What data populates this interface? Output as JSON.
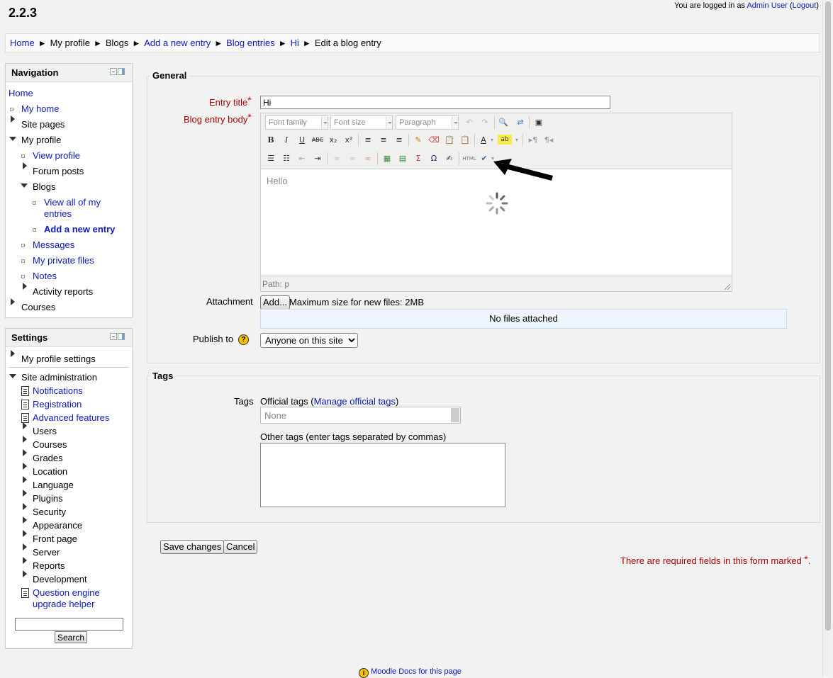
{
  "site": {
    "title": "2.2.3",
    "login_prefix": "You are logged in as ",
    "user_name": "Admin User",
    "logout_label": "Logout"
  },
  "breadcrumb": {
    "items": [
      "Home",
      "My profile",
      "Blogs",
      "Add a new entry",
      "Blog entries",
      "Hi",
      "Edit a blog entry"
    ],
    "separator": "►"
  },
  "navigation": {
    "title": "Navigation",
    "home": "Home",
    "my_home": "My home",
    "site_pages": "Site pages",
    "my_profile": "My profile",
    "view_profile": "View profile",
    "forum_posts": "Forum posts",
    "blogs": "Blogs",
    "view_all_line1": "View all of my",
    "view_all_line2": "entries",
    "add_new_entry": "Add a new entry",
    "messages": "Messages",
    "my_private_files": "My private files",
    "notes": "Notes",
    "activity_reports": "Activity reports",
    "courses": "Courses"
  },
  "settings": {
    "title": "Settings",
    "my_profile_settings": "My profile settings",
    "site_administration": "Site administration",
    "notifications": "Notifications",
    "registration": "Registration",
    "advanced_features": "Advanced features",
    "users": "Users",
    "courses": "Courses",
    "grades": "Grades",
    "location": "Location",
    "language": "Language",
    "plugins": "Plugins",
    "security": "Security",
    "appearance": "Appearance",
    "front_page": "Front page",
    "server": "Server",
    "reports": "Reports",
    "development": "Development",
    "question_engine_line1": "Question engine",
    "question_engine_line2": "upgrade helper",
    "search_button": "Search"
  },
  "form": {
    "general_legend": "General",
    "entry_title_label": "Entry title",
    "entry_title_value": "Hi",
    "body_label": "Blog entry body",
    "editor": {
      "font_family": "Font family",
      "font_size": "Font size",
      "format": "Paragraph",
      "content": "Hello",
      "path": "Path: p"
    },
    "attachment_label": "Attachment",
    "add_button": "Add...",
    "max_size": "Maximum size for new files: 2MB",
    "no_files": "No files attached",
    "publish_label": "Publish to",
    "publish_value": "Anyone on this site",
    "tags_legend": "Tags",
    "tags_label": "Tags",
    "official_tags_prefix": "Official tags (",
    "manage_official_tags": "Manage official tags",
    "official_tags_suffix": ")",
    "official_tags_option": "None",
    "other_tags_label": "Other tags (enter tags separated by commas)",
    "save_button": "Save changes",
    "cancel_button": "Cancel",
    "required_note": "There are required fields in this form marked",
    "required_star": "*",
    "required_period": "."
  },
  "footer": {
    "moodle_docs": "Moodle Docs for this page"
  },
  "colors": {
    "link": "#0b1bbb",
    "required": "#aa0000",
    "files_box": "#eef5ff"
  }
}
